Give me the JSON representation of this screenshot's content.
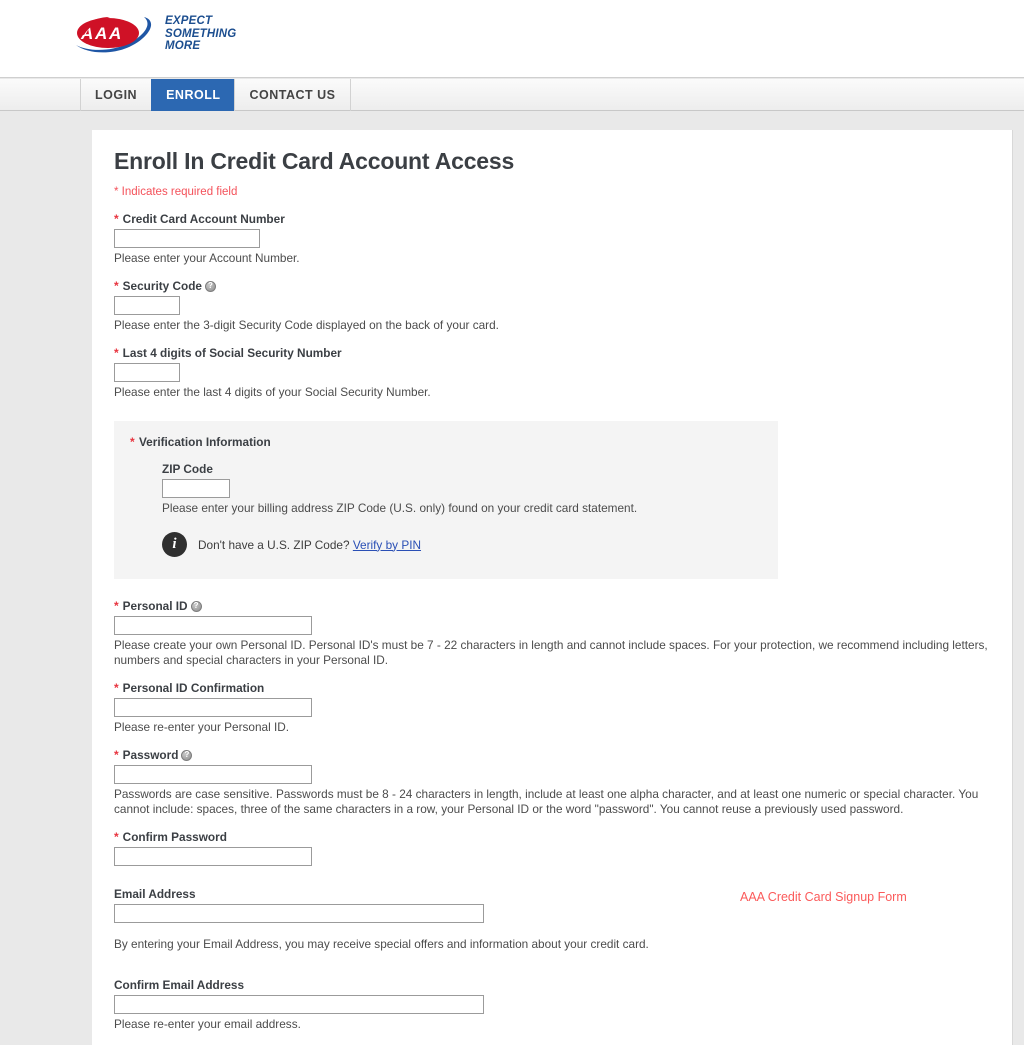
{
  "brand": {
    "logo_alt": "AAA",
    "tagline_lines": [
      "EXPECT",
      "SOMETHING",
      "MORE"
    ]
  },
  "nav": {
    "tabs": [
      {
        "label": "LOGIN",
        "active": false
      },
      {
        "label": "ENROLL",
        "active": true
      },
      {
        "label": "CONTACT US",
        "active": false
      }
    ]
  },
  "page": {
    "title": "Enroll In Credit Card Account Access",
    "required_note": "* Indicates required field"
  },
  "fields": {
    "account": {
      "label": "Credit Card Account Number",
      "required": true,
      "value": "",
      "hint": "Please enter your Account Number."
    },
    "security_code": {
      "label": "Security Code",
      "required": true,
      "has_help": true,
      "value": "",
      "hint": "Please enter the 3-digit Security Code displayed on the back of your card."
    },
    "ssn_last4": {
      "label": "Last 4 digits of Social Security Number",
      "required": true,
      "value": "",
      "hint": "Please enter the last 4 digits of your Social Security Number."
    },
    "zip": {
      "label": "ZIP Code",
      "required": false,
      "value": "",
      "hint": "Please enter your billing address ZIP Code (U.S. only) found on your credit card statement."
    },
    "personal_id": {
      "label": "Personal ID",
      "required": true,
      "has_help": true,
      "value": "",
      "hint": "Please create your own Personal ID.  Personal ID's must be 7 - 22 characters in length and cannot include spaces.  For your protection, we recommend including letters, numbers and special characters in your Personal ID."
    },
    "personal_id_confirm": {
      "label": "Personal ID Confirmation",
      "required": true,
      "value": "",
      "hint": "Please re-enter your Personal ID."
    },
    "password": {
      "label": "Password",
      "required": true,
      "has_help": true,
      "value": "",
      "hint": "Passwords are case sensitive. Passwords must be 8 - 24 characters in length, include at least one alpha character, and at least one numeric or special character.  You cannot include: spaces, three of the same characters in a row, your Personal ID or the word \"password\". You cannot reuse a previously used password."
    },
    "confirm_password": {
      "label": "Confirm Password",
      "required": true,
      "value": "",
      "hint": ""
    },
    "email": {
      "label": "Email Address",
      "required": false,
      "value": "",
      "hint": "By entering your Email Address, you may receive special offers and information about your credit card."
    },
    "confirm_email": {
      "label": "Confirm Email Address",
      "required": false,
      "value": "",
      "hint": "Please re-enter your email address."
    }
  },
  "verification": {
    "title": "Verification Information",
    "required": true,
    "note_prefix": "Don't have a U.S. ZIP Code? ",
    "note_link": "Verify by PIN",
    "info_icon_glyph": "i"
  },
  "annotation": {
    "text": "AAA Credit Card Signup Form",
    "color": "#fb5a5a"
  },
  "icons": {
    "help_glyph": "?"
  },
  "colors": {
    "accent_blue": "#2c68b2",
    "required_red": "#e8343f",
    "link_blue": "#2a4fb5",
    "page_bg": "#e9e9e9",
    "panel_bg": "#f4f4f4"
  }
}
